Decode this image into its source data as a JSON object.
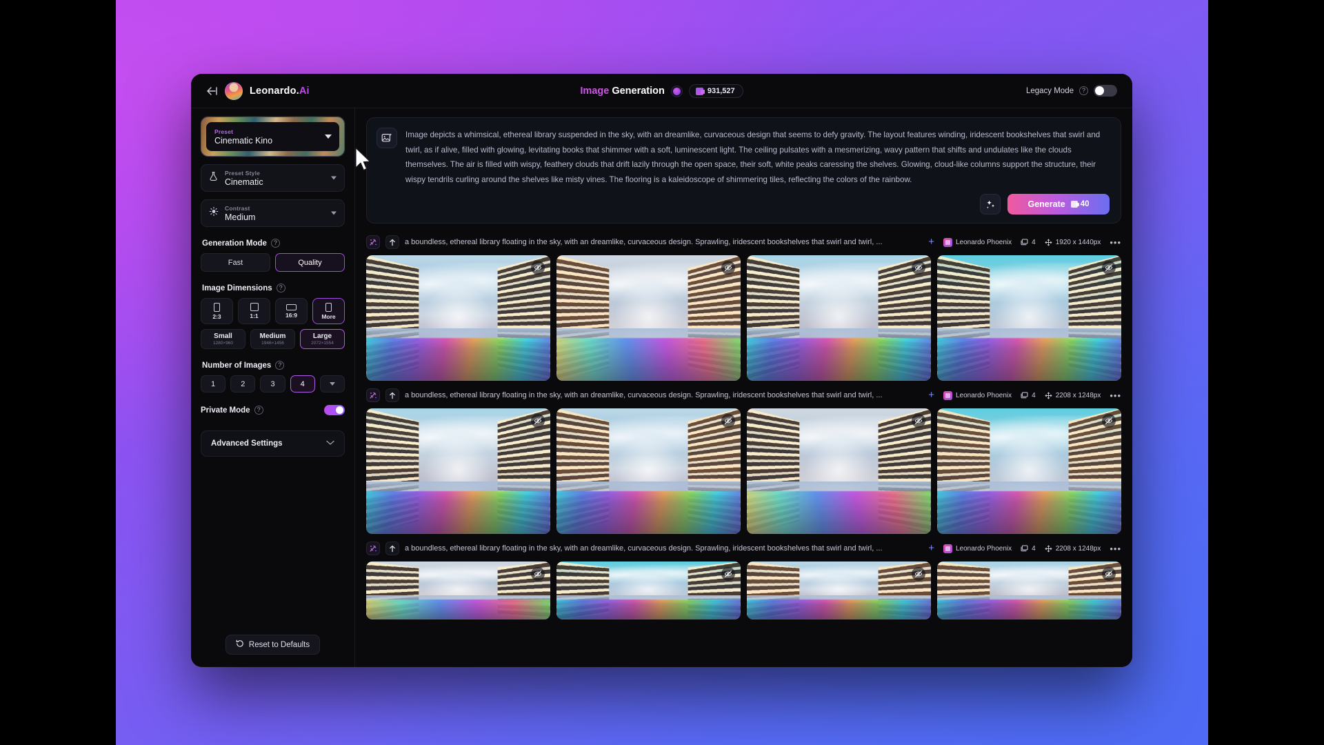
{
  "window": {
    "topbar": {
      "back_icon": "back-arrow-icon",
      "avatar": "user-avatar",
      "brand_name": "Leonardo.",
      "brand_suffix": "Ai",
      "page_title_accent": "Image",
      "page_title_rest": "Generation",
      "help_icon": "help-circle-icon",
      "credits": "931,527",
      "credits_icon": "token-coin-icon",
      "legacy_mode_label": "Legacy Mode",
      "legacy_mode_help": "?",
      "legacy_mode_on": false
    }
  },
  "sidebar": {
    "preset": {
      "label": "Preset",
      "value": "Cinematic Kino"
    },
    "preset_style": {
      "label": "Preset Style",
      "value": "Cinematic",
      "icon": "flask-icon"
    },
    "contrast": {
      "label": "Contrast",
      "value": "Medium",
      "icon": "brightness-icon"
    },
    "generation_mode": {
      "title": "Generation Mode",
      "help": "?",
      "options": [
        "Fast",
        "Quality"
      ],
      "selected": "Quality"
    },
    "image_dimensions": {
      "title": "Image Dimensions",
      "help": "?",
      "ratios": [
        {
          "label": "2:3",
          "glyph": "portrait-icon"
        },
        {
          "label": "1:1",
          "glyph": "square-icon"
        },
        {
          "label": "16:9",
          "glyph": "landscape-icon"
        },
        {
          "label": "More",
          "glyph": "more-icon"
        }
      ],
      "selected_ratio": "More",
      "sizes": [
        {
          "name": "Small",
          "dims": "1280×960"
        },
        {
          "name": "Medium",
          "dims": "1946×1456"
        },
        {
          "name": "Large",
          "dims": "2072×1554"
        }
      ],
      "selected_size": "Large"
    },
    "number_of_images": {
      "title": "Number of Images",
      "help": "?",
      "options": [
        "1",
        "2",
        "3",
        "4"
      ],
      "selected": "4",
      "more_icon": "chevron-down-icon"
    },
    "private_mode": {
      "label": "Private Mode",
      "help": "?",
      "on": true
    },
    "advanced_settings": {
      "label": "Advanced Settings",
      "icon": "chevron-down-icon"
    },
    "reset": {
      "label": "Reset to Defaults",
      "icon": "reset-icon"
    }
  },
  "main": {
    "prompt": {
      "icon": "image-prompt-icon",
      "text": "Image depicts a whimsical, ethereal library suspended in the sky, with an dreamlike, curvaceous design that seems to defy gravity. The layout features winding, iridescent bookshelves that swirl and twirl, as if alive, filled with glowing, levitating books that shimmer with a soft, luminescent light. The ceiling pulsates with a mesmerizing, wavy pattern that shifts and undulates like the clouds themselves. The air is filled with wispy, feathery clouds that drift lazily through the open space, their soft, white peaks caressing the shelves. Glowing, cloud-like columns support the structure, their wispy tendrils curling around the shelves like misty vines. The flooring is a kaleidoscope of shimmering tiles, reflecting the colors of the rainbow.",
      "magic_icon": "sparkles-icon",
      "generate_label": "Generate",
      "generate_cost": "40"
    },
    "rows": [
      {
        "variation_icon": "variation-icon",
        "upscale_icon": "upscale-arrow-icon",
        "prompt": "a boundless, ethereal library floating in the sky, with an dreamlike, curvaceous design. Sprawling, iridescent bookshelves that swirl and twirl, ...",
        "add_icon": "plus-icon",
        "model_icon": "leonardo-phoenix-icon",
        "model": "Leonardo Phoenix",
        "count_icon": "images-icon",
        "count": "4",
        "resolution_icon": "resize-icon",
        "resolution": "1920 x 1440px",
        "more_icon": "ellipsis-icon",
        "thumb_eye_icon": "eye-off-icon"
      },
      {
        "variation_icon": "variation-icon",
        "upscale_icon": "upscale-arrow-icon",
        "prompt": "a boundless, ethereal library floating in the sky, with an dreamlike, curvaceous design. Sprawling, iridescent bookshelves that swirl and twirl, ...",
        "add_icon": "plus-icon",
        "model_icon": "leonardo-phoenix-icon",
        "model": "Leonardo Phoenix",
        "count_icon": "images-icon",
        "count": "4",
        "resolution_icon": "resize-icon",
        "resolution": "2208 x 1248px",
        "more_icon": "ellipsis-icon",
        "thumb_eye_icon": "eye-off-icon"
      },
      {
        "variation_icon": "variation-icon",
        "upscale_icon": "upscale-arrow-icon",
        "prompt": "a boundless, ethereal library floating in the sky, with an dreamlike, curvaceous design. Sprawling, iridescent bookshelves that swirl and twirl, ...",
        "add_icon": "plus-icon",
        "model_icon": "leonardo-phoenix-icon",
        "model": "Leonardo Phoenix",
        "count_icon": "images-icon",
        "count": "4",
        "resolution_icon": "resize-icon",
        "resolution": "2208 x 1248px",
        "more_icon": "ellipsis-icon",
        "thumb_eye_icon": "eye-off-icon"
      }
    ]
  },
  "colors": {
    "accent_purple": "#c04bf0",
    "accent_pink": "#f05a9e",
    "accent_blue": "#6b6ef0",
    "panel_bg": "#0a0a0d",
    "backdrop_from": "#b544ef",
    "backdrop_to": "#4c6ff6"
  },
  "cursor": {
    "icon": "mouse-pointer-icon"
  }
}
